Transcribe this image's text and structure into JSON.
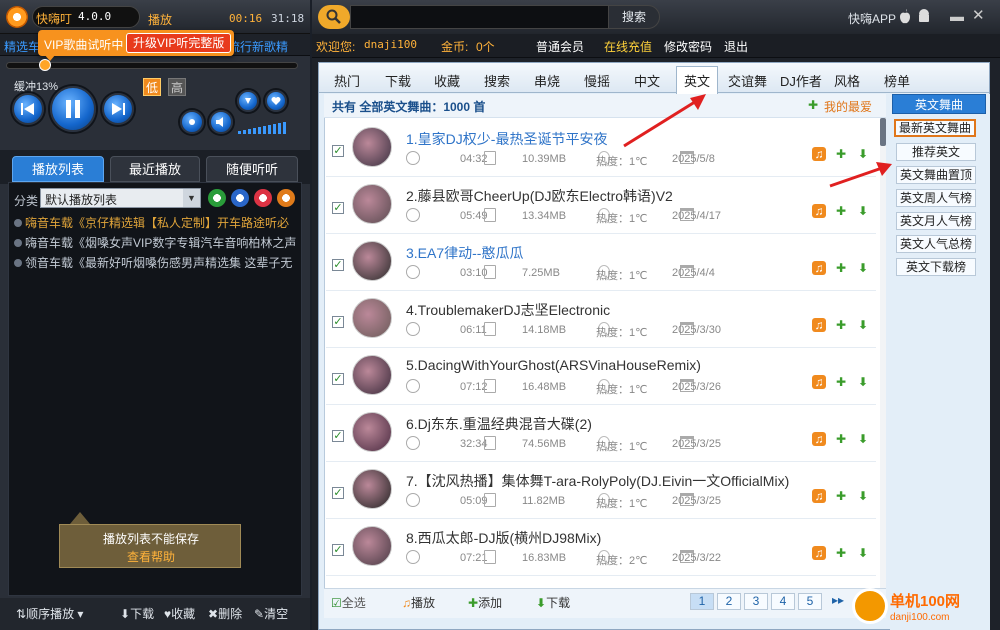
{
  "player": {
    "app_name": "快嗨叮",
    "version": "4.0.0",
    "mode": "播放",
    "time_current": "00:16",
    "time_total": "31:18",
    "marquee_left": "精选车",
    "marquee_right": "流行新歌精",
    "vip_trial": "VIP歌曲试听中",
    "vip_upgrade": "升级VIP听完整版",
    "buffer": "缓冲13%",
    "quality_low": "低",
    "quality_high": "高",
    "progress_fraction": 0.13
  },
  "left_tabs": [
    "播放列表",
    "最近播放",
    "随便听听"
  ],
  "category": {
    "label": "分类",
    "value": "默认播放列表"
  },
  "playlist": [
    {
      "prefix": "嗨音车载《",
      "highlight": "京仔精选辑【私人定制】开车路途听必",
      "hl": true
    },
    {
      "prefix": "嗨音车载《",
      "highlight": "烟嗓女声VIP数字专辑汽车音响柏林之声",
      "hl": false
    },
    {
      "prefix": "领音车载《",
      "highlight": "最新好听烟嗓伤感男声精选集 这辈子无",
      "hl": false
    }
  ],
  "tip": {
    "title": "播放列表不能保存",
    "help": "查看帮助"
  },
  "left_footer": {
    "order": "顺序播放",
    "download": "下载",
    "favorite": "收藏",
    "delete": "删除",
    "clear": "清空"
  },
  "topbar": {
    "search_button": "搜索",
    "app_download": "快嗨APP"
  },
  "userbar": {
    "welcome": "欢迎您:",
    "username": "dnaji100",
    "coins_label": "金币:",
    "coins": "0个",
    "member": "普通会员",
    "recharge": "在线充值",
    "change_password": "修改密码",
    "logout": "退出"
  },
  "nav_tabs": [
    "热门",
    "下载",
    "收藏",
    "搜索",
    "串烧",
    "慢摇",
    "中文",
    "英文",
    "交谊舞",
    "DJ作者",
    "风格",
    "榜单"
  ],
  "nav_active": "英文",
  "list": {
    "total": "共有 全部英文舞曲：1000 首",
    "my_favorites": "我的最爱",
    "songs": [
      {
        "title": "1.皇家DJ权少-最热圣诞节平安夜",
        "duration": "04:32",
        "size": "10.39MB",
        "heat": "热度：1℃",
        "date": "2025/5/8",
        "blue": true
      },
      {
        "title": "2.藤县欧哥CheerUp(DJ欧东Electro韩语)V2",
        "duration": "05:49",
        "size": "13.34MB",
        "heat": "热度：1℃",
        "date": "2025/4/17",
        "blue": false
      },
      {
        "title": "3.EA7律动--憨瓜瓜",
        "duration": "03:10",
        "size": "7.25MB",
        "heat": "热度：1℃",
        "date": "2025/4/4",
        "blue": true
      },
      {
        "title": "4.TroublemakerDJ志坚Electronic",
        "duration": "06:11",
        "size": "14.18MB",
        "heat": "热度：1℃",
        "date": "2025/3/30",
        "blue": false
      },
      {
        "title": "5.DacingWithYourGhost(ARSVinaHouseRemix)",
        "duration": "07:12",
        "size": "16.48MB",
        "heat": "热度：1℃",
        "date": "2025/3/26",
        "blue": false
      },
      {
        "title": "6.Dj东东.重温经典混音大碟(2)",
        "duration": "32:34",
        "size": "74.56MB",
        "heat": "热度：1℃",
        "date": "2025/3/25",
        "blue": false
      },
      {
        "title": "7.【沈风热播】集体舞T-ara-RolyPoly(DJ.Eivin一文OfficialMix)",
        "duration": "05:09",
        "size": "11.82MB",
        "heat": "热度：1℃",
        "date": "2025/3/25",
        "blue": false
      },
      {
        "title": "8.西瓜太郎-DJ版(横州DJ98Mix)",
        "duration": "07:21",
        "size": "16.83MB",
        "heat": "热度：2℃",
        "date": "2025/3/22",
        "blue": false
      }
    ],
    "footer": {
      "select_all": "全选",
      "play": "播放",
      "add": "添加",
      "download": "下载"
    },
    "pages": [
      "1",
      "2",
      "3",
      "4",
      "5"
    ],
    "page_next": "▸▸"
  },
  "categories": {
    "active": "英文舞曲",
    "items": [
      "最新英文舞曲",
      "推荐英文",
      "英文舞曲置顶",
      "英文周人气榜",
      "英文月人气榜",
      "英文人气总榜",
      "英文下载榜"
    ],
    "selected": "最新英文舞曲"
  },
  "watermark": {
    "site": "单机100网",
    "url": "danji100.com"
  },
  "colors": {
    "accent_orange": "#f7921e",
    "link_blue": "#2f74c8",
    "tab_blue": "#2a7ed6"
  }
}
